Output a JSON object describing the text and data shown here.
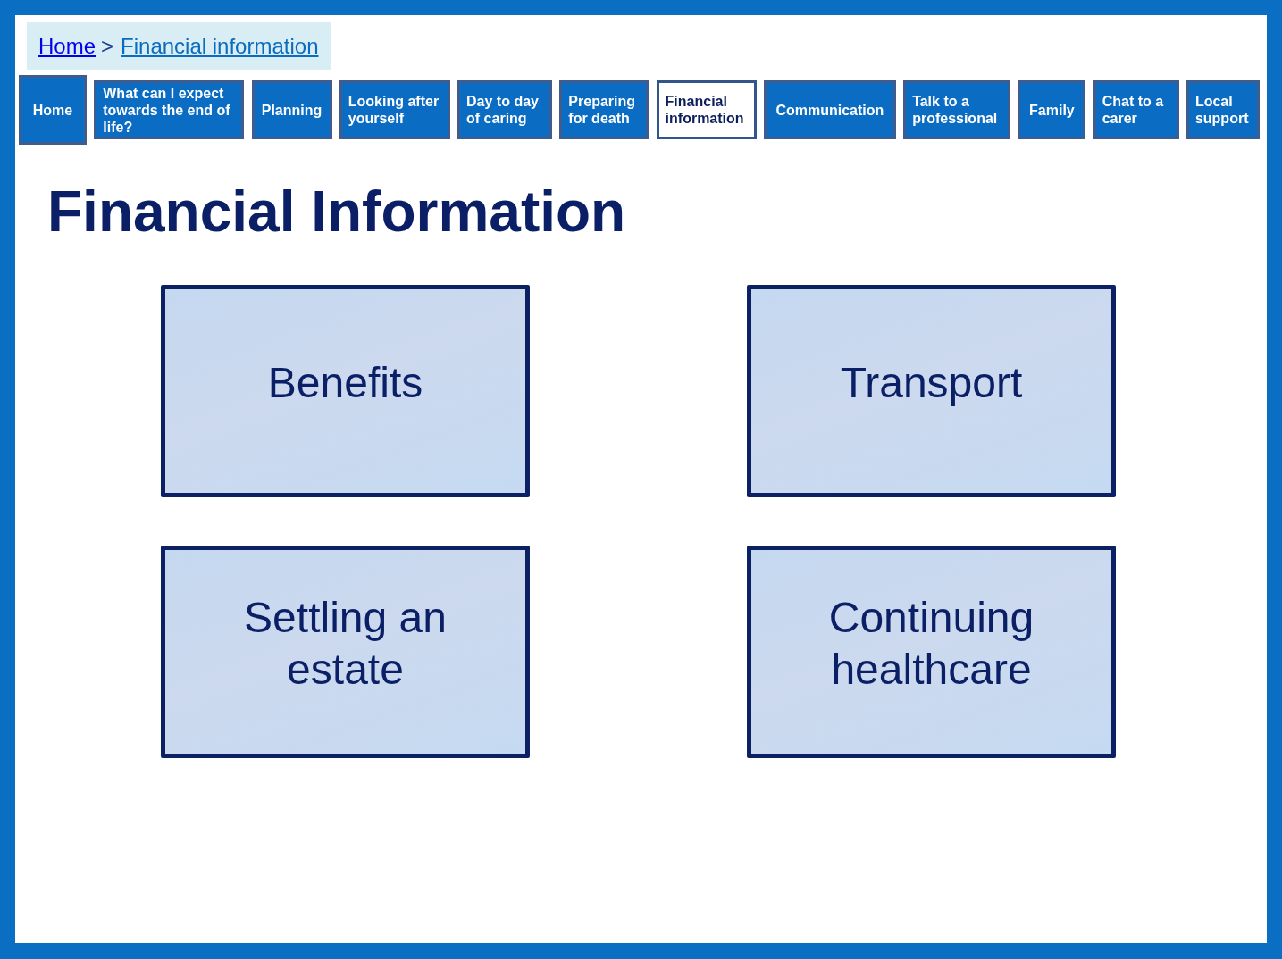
{
  "breadcrumb": {
    "items": [
      {
        "label": "Home",
        "current": false
      },
      {
        "label": "Financial information",
        "current": true
      }
    ],
    "separator": ">"
  },
  "nav_tabs": [
    {
      "label": "Home",
      "selected": false
    },
    {
      "label": "What can I expect towards the end of life?",
      "selected": false
    },
    {
      "label": "Planning",
      "selected": false
    },
    {
      "label": "Looking after yourself",
      "selected": false
    },
    {
      "label": "Day to day of caring",
      "selected": false
    },
    {
      "label": "Preparing for death",
      "selected": false
    },
    {
      "label": "Financial information",
      "selected": true
    },
    {
      "label": "Communication",
      "selected": false
    },
    {
      "label": "Talk to a professional",
      "selected": false
    },
    {
      "label": "Family",
      "selected": false
    },
    {
      "label": "Chat to a carer",
      "selected": false
    },
    {
      "label": "Local support",
      "selected": false
    }
  ],
  "heading": "Financial Information",
  "cards": [
    {
      "label": "Benefits"
    },
    {
      "label": "Transport"
    },
    {
      "label": "Settling an estate"
    },
    {
      "label": "Continuing healthcare"
    }
  ]
}
